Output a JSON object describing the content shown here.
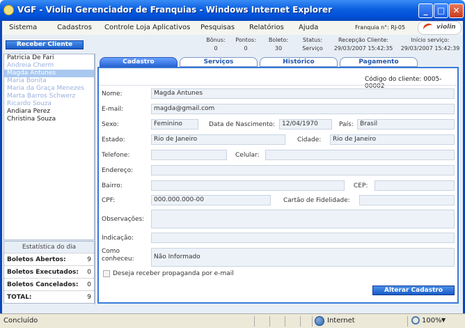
{
  "window": {
    "title": "VGF - Violin Gerenciador de Franquias - Windows Internet Explorer"
  },
  "menu": {
    "items": [
      "Sistema",
      "Cadastros",
      "Controle Loja",
      "Aplicativos",
      "Pesquisas",
      "Relatórios",
      "Ajuda"
    ],
    "franquia": "Franquia n°: RJ-05",
    "logo": "violin"
  },
  "toolbar": {
    "receber_label": "Receber Cliente",
    "stats": [
      {
        "label": "Bônus:",
        "value": "0"
      },
      {
        "label": "Pontos:",
        "value": "0"
      },
      {
        "label": "Boleto:",
        "value": "30"
      },
      {
        "label": "Status:",
        "value": "Serviço"
      },
      {
        "label": "Recepção Cliente:",
        "value": "29/03/2007 15:42:35"
      },
      {
        "label": "Início serviço:",
        "value": "29/03/2007 15:42:39"
      }
    ]
  },
  "clients": [
    {
      "name": "Patricia De Fari",
      "state": "normal"
    },
    {
      "name": "Andreia Cherm",
      "state": "dim"
    },
    {
      "name": "Magda Antunes",
      "state": "selected"
    },
    {
      "name": "Maria Bonita",
      "state": "dim"
    },
    {
      "name": "Maria da Graça Menezes",
      "state": "dim"
    },
    {
      "name": "Marta Barros Schwerz",
      "state": "dim"
    },
    {
      "name": "Ricardo Souza",
      "state": "dim"
    },
    {
      "name": "Andiara Perez",
      "state": "normal"
    },
    {
      "name": "Christina Souza",
      "state": "normal"
    }
  ],
  "stats_panel": {
    "title": "Estatística do dia",
    "rows": [
      {
        "label": "Boletos Abertos:",
        "value": "9"
      },
      {
        "label": "Boletos Executados:",
        "value": "0"
      },
      {
        "label": "Boletos Cancelados:",
        "value": "0"
      },
      {
        "label": "TOTAL:",
        "value": "9"
      }
    ]
  },
  "tabs": [
    "Cadastro",
    "Serviços",
    "Histórico",
    "Pagamento"
  ],
  "form": {
    "codigo": "Código do cliente: 0005-00002",
    "labels": {
      "nome": "Nome:",
      "email": "E-mail:",
      "sexo": "Sexo:",
      "nascimento": "Data de Nascimento:",
      "pais": "País:",
      "estado": "Estado:",
      "cidade": "Cidade:",
      "telefone": "Telefone:",
      "celular": "Celular:",
      "endereco": "Endereço:",
      "bairro": "Bairro:",
      "cep": "CEP:",
      "cpf": "CPF:",
      "cartao": "Cartão de Fidelidade:",
      "observacoes": "Observações:",
      "indicacao": "Indicação:",
      "conheceu": "Como conheceu:"
    },
    "values": {
      "nome": "Magda Antunes",
      "email": "magda@gmail.com",
      "sexo": "Feminino",
      "nascimento": "12/04/1970",
      "pais": "Brasil",
      "estado": "Rio de Janeiro",
      "cidade": "Rio de Janeiro",
      "telefone": "",
      "celular": "",
      "endereco": "",
      "bairro": "",
      "cep": "",
      "cpf": "000.000.000-00",
      "cartao": "",
      "observacoes": "",
      "indicacao": "",
      "conheceu": "Não Informado"
    },
    "checkbox_label": "Deseja receber propaganda por e-mail",
    "submit_label": "Alterar Cadastro"
  },
  "statusbar": {
    "left": "Concluído",
    "zone": "Internet",
    "zoom": "100%"
  }
}
